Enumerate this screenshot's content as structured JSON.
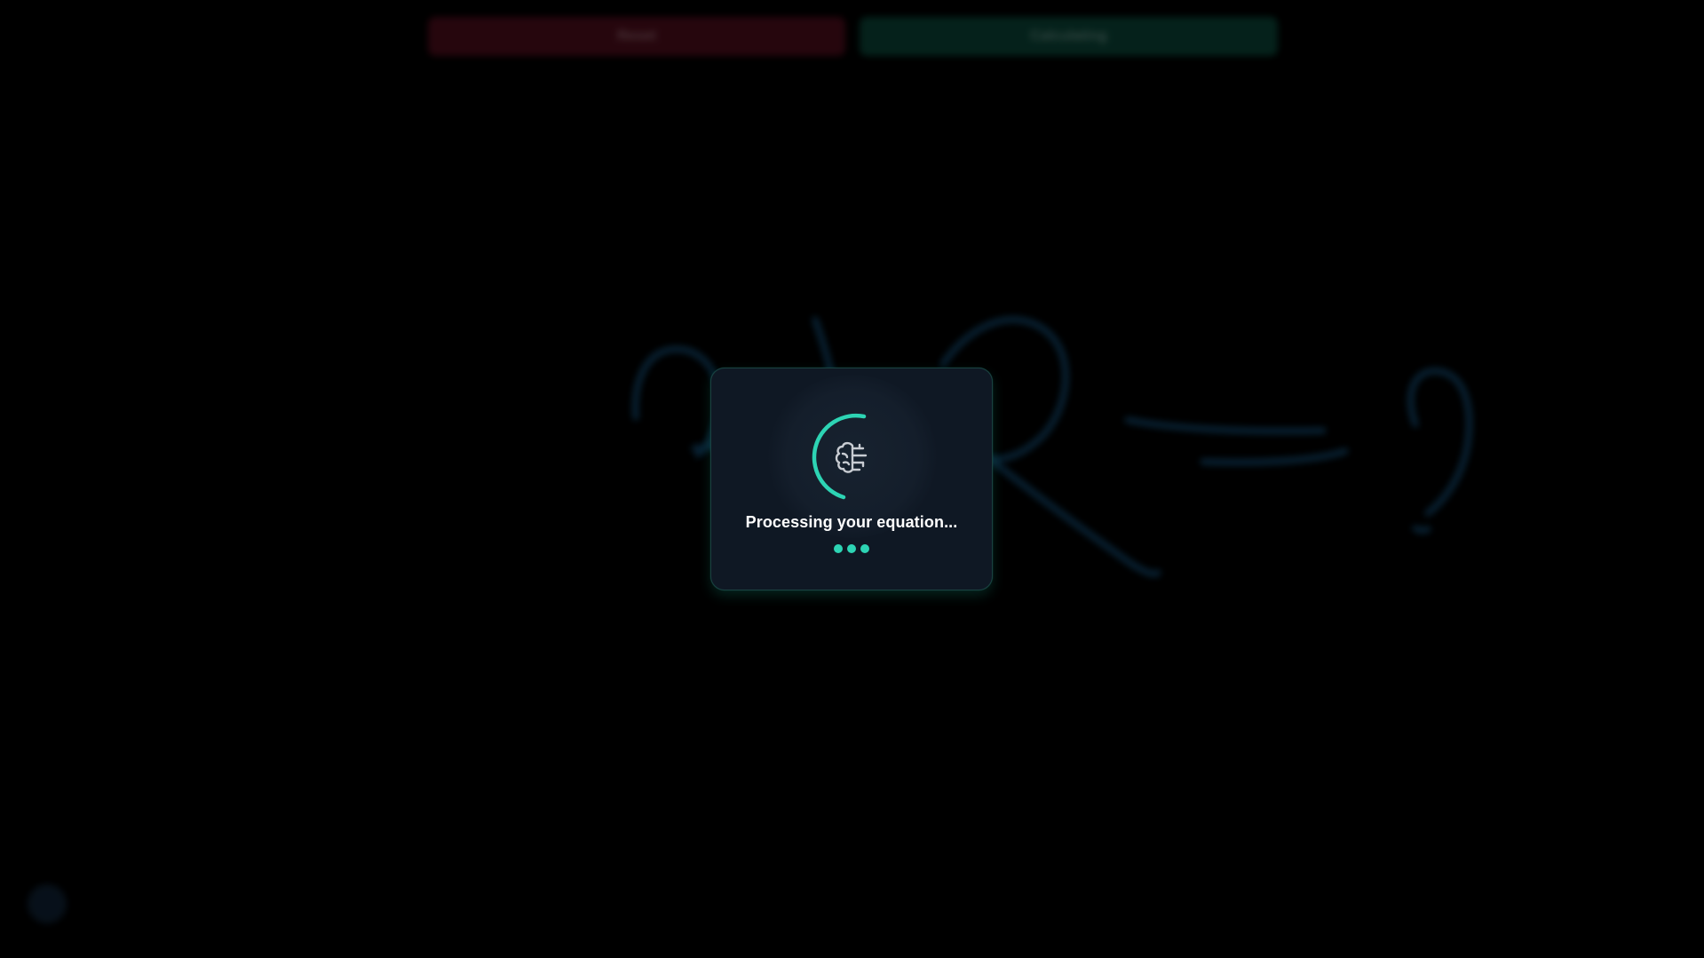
{
  "toolbar": {
    "reset_label": "Reset",
    "calculate_label": "Calculating"
  },
  "canvas": {
    "ink_color": "#0f3855",
    "handwritten_content": "a+R=?"
  },
  "loading": {
    "message": "Processing your equation...",
    "icon": "brain-icon",
    "accent_color": "#2dd4b4",
    "dot_count": 3
  },
  "colors": {
    "background": "#000000",
    "reset_button": "#3b0a15",
    "calculate_button": "#08342a",
    "modal_background": "#0f1824",
    "accent": "#2dd4b4"
  }
}
